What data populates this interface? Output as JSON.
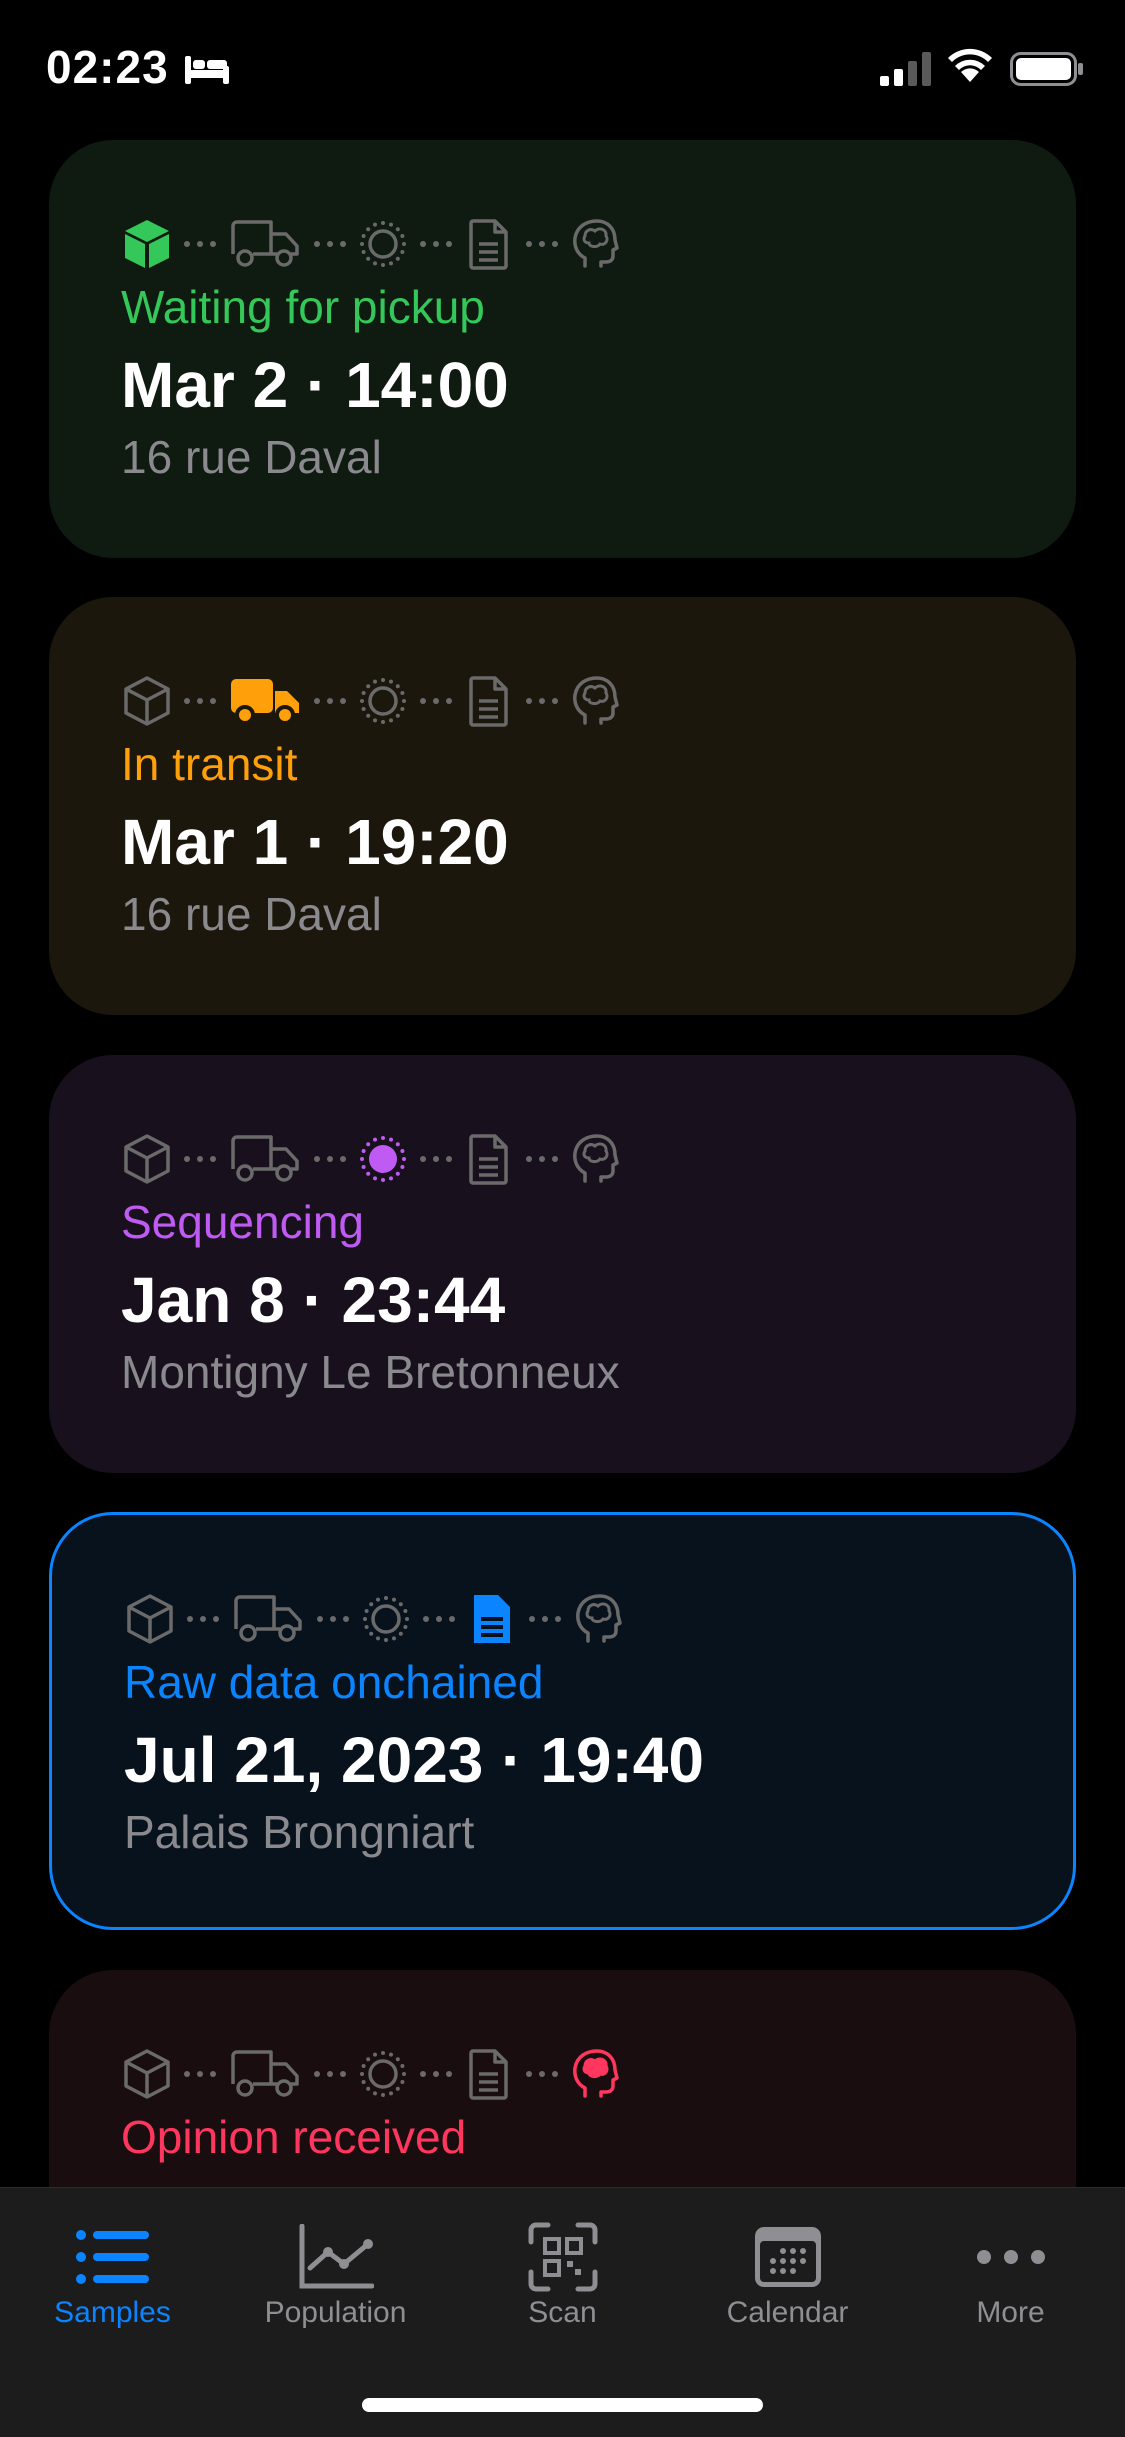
{
  "status_bar": {
    "time": "02:23"
  },
  "colors": {
    "green": "#34c759",
    "orange": "#ff9f0a",
    "purple": "#bf5af2",
    "blue": "#0a84ff",
    "red": "#ff375f",
    "inactive_icon": "#6a6a6a"
  },
  "steps": [
    "package-icon",
    "truck-icon",
    "sun-icon",
    "document-icon",
    "brain-icon"
  ],
  "samples": [
    {
      "status": "Waiting for pickup",
      "date": "Mar 2 · 14:00",
      "location": "16 rue Daval",
      "active_step": "package",
      "color": "#34c759",
      "background": "#0f1a10",
      "selected": false
    },
    {
      "status": "In transit",
      "date": "Mar 1 · 19:20",
      "location": "16 rue Daval",
      "active_step": "truck",
      "color": "#ff9f0a",
      "background": "#1c170d",
      "selected": false
    },
    {
      "status": "Sequencing",
      "date": "Jan 8 · 23:44",
      "location": "Montigny Le Bretonneux",
      "active_step": "sun",
      "color": "#bf5af2",
      "background": "#18111d",
      "selected": false
    },
    {
      "status": "Raw data onchained",
      "date": "Jul 21, 2023 · 19:40",
      "location": "Palais Brongniart",
      "active_step": "document",
      "color": "#0a84ff",
      "background": "#08121d",
      "selected": true
    },
    {
      "status": "Opinion received",
      "date": "",
      "location": "",
      "active_step": "brain",
      "color": "#ff375f",
      "background": "#1a0d0f",
      "selected": false
    }
  ],
  "tab_bar": {
    "tabs": [
      {
        "label": "Samples",
        "icon": "list-icon",
        "active": true
      },
      {
        "label": "Population",
        "icon": "chart-icon",
        "active": false
      },
      {
        "label": "Scan",
        "icon": "qr-scan-icon",
        "active": false
      },
      {
        "label": "Calendar",
        "icon": "calendar-icon",
        "active": false
      },
      {
        "label": "More",
        "icon": "ellipsis-icon",
        "active": false
      }
    ]
  }
}
